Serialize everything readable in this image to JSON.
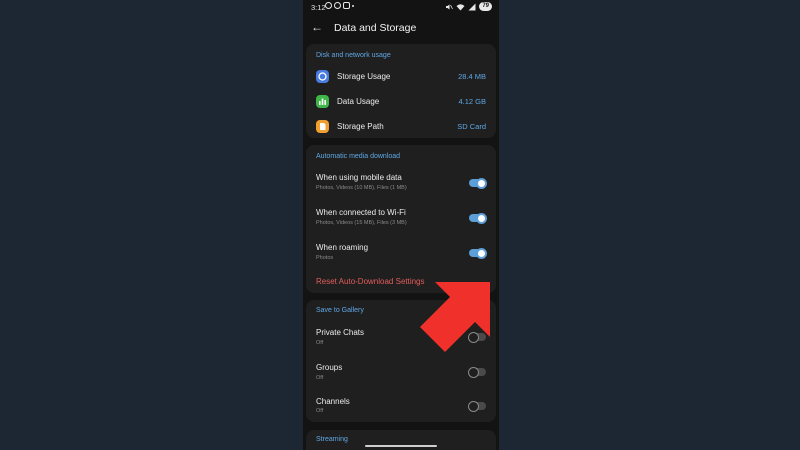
{
  "status_bar": {
    "time": "3:12",
    "battery": "79"
  },
  "header": {
    "title": "Data and Storage"
  },
  "disk_section": {
    "title": "Disk and network usage",
    "items": [
      {
        "label": "Storage Usage",
        "value": "28.4 MB",
        "icon": "storage-icon",
        "color": "#4a7be0"
      },
      {
        "label": "Data Usage",
        "value": "4.12 GB",
        "icon": "chart-icon",
        "color": "#3fb54a"
      },
      {
        "label": "Storage Path",
        "value": "SD Card",
        "icon": "sd-card-icon",
        "color": "#f0a030"
      }
    ]
  },
  "auto_download": {
    "title": "Automatic media download",
    "items": [
      {
        "label": "When using mobile data",
        "sub": "Photos, Videos (10 MB), Files (1 MB)",
        "on": true
      },
      {
        "label": "When connected to Wi-Fi",
        "sub": "Photos, Videos (15 MB), Files (3 MB)",
        "on": true
      },
      {
        "label": "When roaming",
        "sub": "Photos",
        "on": true
      }
    ],
    "reset_label": "Reset Auto-Download Settings"
  },
  "save_to_gallery": {
    "title": "Save to Gallery",
    "items": [
      {
        "label": "Private Chats",
        "sub": "Off",
        "on": false
      },
      {
        "label": "Groups",
        "sub": "Off",
        "on": false
      },
      {
        "label": "Channels",
        "sub": "Off",
        "on": false
      }
    ]
  },
  "streaming": {
    "title": "Streaming"
  },
  "colors": {
    "accent": "#5b9ed8",
    "danger": "#e35c5c",
    "arrow": "#f0302a",
    "background": "#1c2733"
  }
}
